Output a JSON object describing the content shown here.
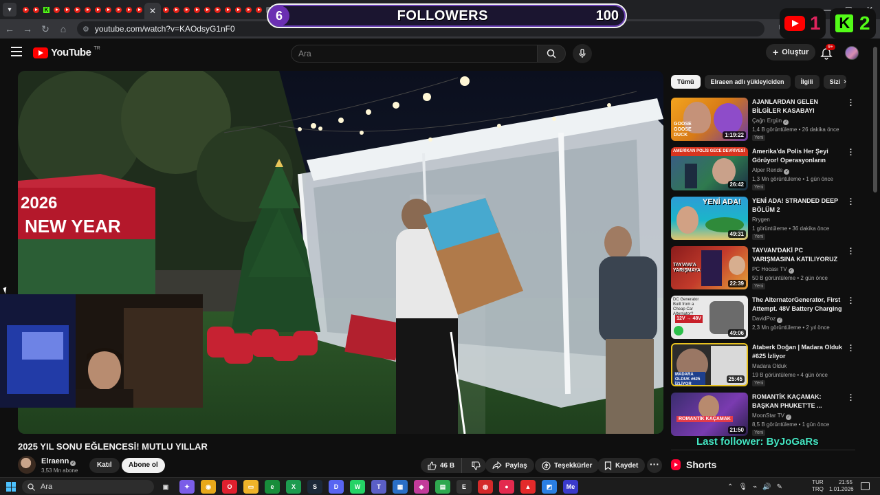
{
  "browser": {
    "url": "youtube.com/watch?v=KAOdsyG1nF0"
  },
  "overlay": {
    "followers_current": "6",
    "followers_label": "FOLLOWERS",
    "followers_goal": "100",
    "youtube_count": "1",
    "kick_count": "2",
    "last_follower": "Last follower: ByJoGaRs"
  },
  "header": {
    "brand": "YouTube",
    "country_code": "TR",
    "search_placeholder": "Ara",
    "create_label": "Oluştur",
    "notifications_badge": "9+"
  },
  "video": {
    "scene_text_1": "2026",
    "scene_text_2": "NEW YEAR",
    "title": "2025 YIL SONU EĞLENCESİ! MUTLU YILLAR",
    "channel": "Elraenn",
    "subscribers": "3,53 Mn abone",
    "join_label": "Katıl",
    "subscribe_label": "Abone ol",
    "likes": "46 B",
    "share_label": "Paylaş",
    "thanks_label": "Teşekkürler",
    "save_label": "Kaydet"
  },
  "sidebar": {
    "chips": [
      "Tümü",
      "Elraeen adlı yükleyiciden",
      "İlgili",
      "Sizi"
    ],
    "recommendations": [
      {
        "title": "AJANLARDAN GELEN BİLGİLER KASABAYI TEHLİKEYE SOKTU!...",
        "channel": "Çağrı Ergün",
        "meta": "1,4 B görüntüleme • 26 dakika önce",
        "duration": "1:19:22",
        "badge": "Yeni",
        "verified": true
      },
      {
        "title": "Amerika'da Polis Her Şeyi Görüyor! Operasyonların Perde...",
        "channel": "Alper Rende",
        "meta": "1,3 Mn görüntüleme • 1 gün önce",
        "duration": "26:42",
        "badge": "Yeni",
        "verified": true
      },
      {
        "title": "YENİ ADA! STRANDED DEEP BÖLÜM 2",
        "channel": "Rrygen",
        "meta": "1 görüntüleme • 36 dakika önce",
        "duration": "49:31",
        "badge": "Yeni",
        "verified": false
      },
      {
        "title": "TAYVAN'DAKİ PC YARIŞMASINA KATILIYORUZ -...",
        "channel": "PC Hocası TV",
        "meta": "50 B görüntüleme • 2 gün önce",
        "duration": "22:39",
        "badge": "Yeni",
        "verified": true
      },
      {
        "title": "The AlternatorGenerator, First Attempt.  48V Battery Charging",
        "channel": "DavidPoz",
        "meta": "2,3 Mn görüntüleme • 2 yıl önce",
        "duration": "49:06",
        "badge": "",
        "verified": true
      },
      {
        "title": "Ataberk Doğan | Madara Olduk #625 İzliyor",
        "channel": "Madara Olduk",
        "meta": "19 B görüntüleme • 4 gün önce",
        "duration": "25:45",
        "badge": "Yeni",
        "verified": false
      },
      {
        "title": "ROMANTİK KAÇAMAK: BAŞKAN PHUKET'TE ...",
        "channel": "MoonStar TV",
        "meta": "8,5 B görüntüleme • 1 gün önce",
        "duration": "21:50",
        "badge": "Yeni",
        "verified": true
      }
    ],
    "thumb_texts": [
      "GOOSE GOOSE DUCK",
      "AMERİKAN POLİS GECE DEVRİYESİ",
      "YENİ ADA!",
      "TAYVAN'A YARIŞMAYA",
      "12V → 48V",
      "MADARA OLDUK #625 İZLİYOR",
      "ROMANTİK KAÇAMAK"
    ],
    "shorts_label": "Shorts"
  },
  "taskbar": {
    "search_placeholder": "Ara",
    "lang_top": "TUR",
    "lang_bottom": "TRQ",
    "time": "21:55",
    "date": "1.01.2026"
  },
  "colors": {
    "background": "#0f0f0f",
    "youtube_red": "#ff0000",
    "kick_green": "#53fc18",
    "last_follower": "#45e6c3"
  }
}
